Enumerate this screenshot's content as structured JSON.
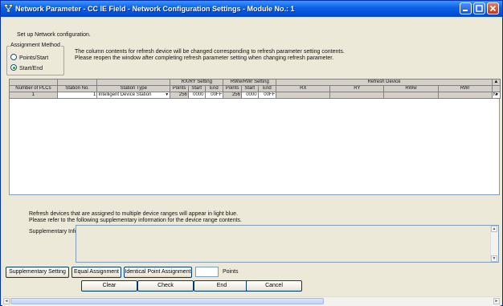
{
  "window": {
    "title": "Network Parameter - CC IE Field - Network Configuration Settings - Module No.: 1"
  },
  "intro": "Set up Network configuration.",
  "assignment": {
    "legend": "Assignment Method",
    "options": [
      "Points/Start",
      "Start/End"
    ],
    "selected": "Start/End"
  },
  "notice": {
    "line1": "The column contents for refresh device will be changed corresponding to refresh parameter setting contents.",
    "line2": "Please reopen the window after completing refresh parameter setting when changing refresh parameter."
  },
  "table": {
    "group_headers": {
      "rx_ry": "RX/RY Setting",
      "rww_rwr": "RWw/RWr Setting",
      "refresh": "Refresh Device"
    },
    "columns": {
      "num_plcs": "Number of PLCs",
      "station_no": "Station No.",
      "station_type": "Station Type",
      "points": "Points",
      "start": "Start",
      "end": "End",
      "rx": "RX",
      "ry": "RY",
      "rww": "RWw",
      "rwr": "RWr"
    },
    "row": {
      "index": "1",
      "station_no": "1",
      "station_type": "Intelligent Device Station",
      "rx_points": "256",
      "rx_start": "0000",
      "rx_end": "00FF",
      "rw_points": "256",
      "rw_start": "0000",
      "rw_end": "00FF",
      "trailing": "N"
    }
  },
  "footnote": {
    "line1": "Refresh devices that are assigned to multiple device ranges will appear in light blue.",
    "line2": "Please refer to the following supplementary information for the device range contents."
  },
  "supplementary_label": "Supplementary Information :",
  "buttons": {
    "supplementary_setting": "Supplementary Setting",
    "equal_assignment": "Equal Assignment",
    "identical_point_assignment": "Identical Point Assignment",
    "points_label": "Points",
    "points_value": "",
    "clear": "Clear",
    "check": "Check",
    "end": "End",
    "cancel": "Cancel"
  },
  "colors": {
    "titlebar": "#0b5fe6",
    "dialog_bg": "#ece9d8",
    "grid_header": "#d4d0c8"
  }
}
